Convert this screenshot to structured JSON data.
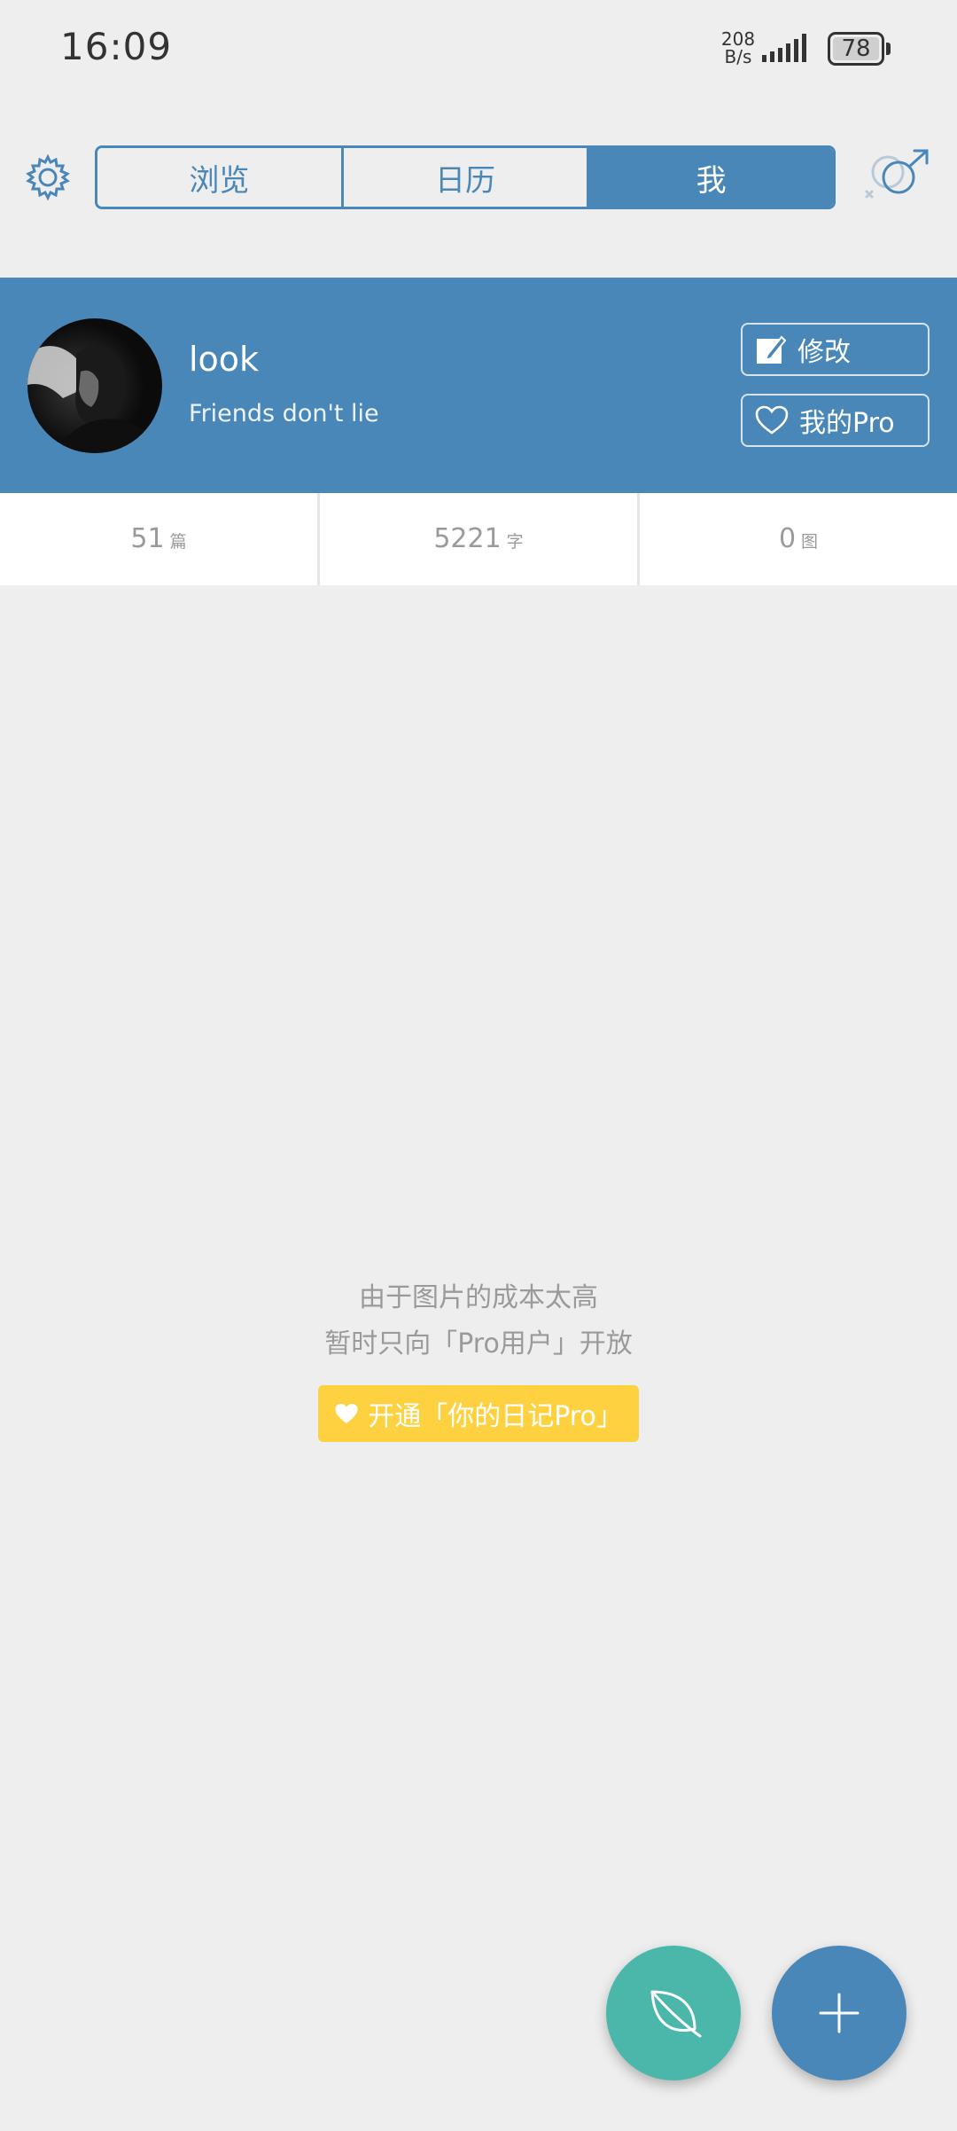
{
  "status_bar": {
    "time": "16:09",
    "net_speed_value": "208",
    "net_speed_unit": "B/s",
    "battery_level": "78",
    "icons": [
      "signal-icon",
      "battery-icon"
    ]
  },
  "top_nav": {
    "tabs": [
      {
        "label": "浏览",
        "active": false
      },
      {
        "label": "日历",
        "active": false
      },
      {
        "label": "我",
        "active": true
      }
    ],
    "icons": [
      "settings-icon",
      "gender-icon"
    ],
    "accent_color": "#4a87b9"
  },
  "profile": {
    "name": "look",
    "bio": "Friends don't lie",
    "edit_label": "修改",
    "pro_label": "我的Pro",
    "banner_color": "#4a87b9"
  },
  "stats": [
    {
      "value": "51",
      "unit": "篇"
    },
    {
      "value": "5221",
      "unit": "字"
    },
    {
      "value": "0",
      "unit": "图"
    }
  ],
  "empty_state": {
    "line1": "由于图片的成本太高",
    "line2": "暂时只向「Pro用户」开放",
    "button_label": "开通「你的日记Pro」",
    "button_color": "#fdd13f"
  },
  "fabs": {
    "leaf": {
      "icon": "leaf-icon",
      "color": "#4bb7ab"
    },
    "add": {
      "icon": "plus-icon",
      "color": "#4a87b9"
    }
  }
}
